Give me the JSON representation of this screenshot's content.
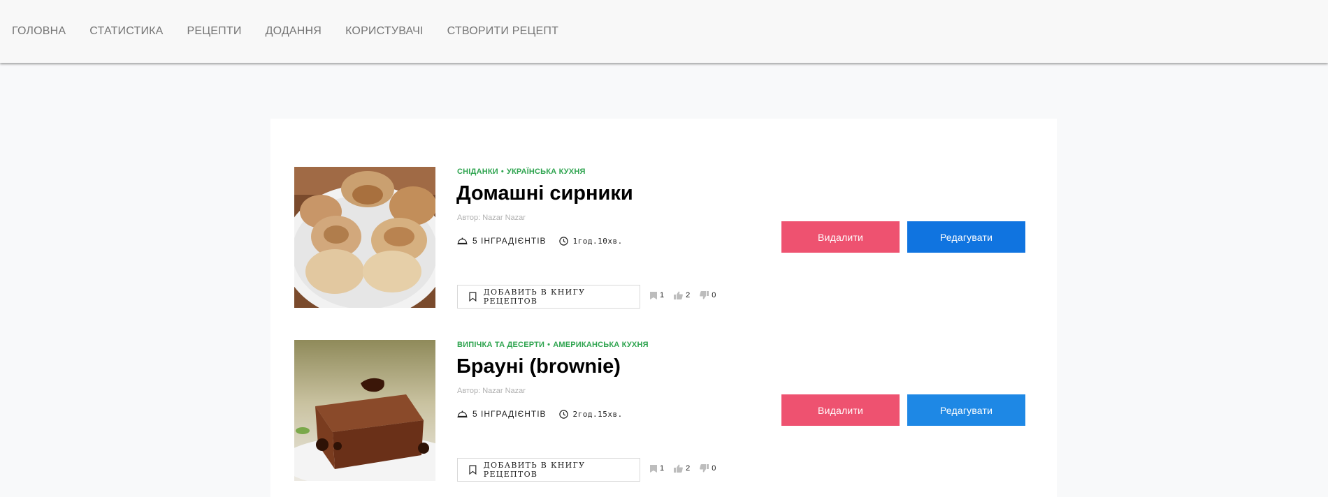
{
  "nav": {
    "items": [
      "Головна",
      "Статистика",
      "Рецепти",
      "Додання",
      "Користувачі",
      "Створити рецепт"
    ]
  },
  "colors": {
    "category": "#2ea44f",
    "delete": "#ee5270",
    "edit_primary": "#1074e0",
    "edit_secondary": "#1e88e5"
  },
  "recipes": [
    {
      "category": "Сніданки",
      "cuisine": "Українська кухня",
      "title": "Домашні сирники",
      "author": "Автор: Nazar Nazar",
      "ingredients": "5 інградієнтів",
      "time": "1год.10хв.",
      "book_label": "Добавить в книгу рецептов",
      "saves": "1",
      "likes": "2",
      "dislikes": "0",
      "delete_label": "Видалити",
      "edit_label": "Редагувати"
    },
    {
      "category": "Випічка та десерти",
      "cuisine": "Американська кухня",
      "title": "Брауні (brownie)",
      "author": "Автор: Nazar Nazar",
      "ingredients": "5 інградієнтів",
      "time": "2год.15хв.",
      "book_label": "Добавить в книгу рецептов",
      "saves": "1",
      "likes": "2",
      "dislikes": "0",
      "delete_label": "Видалити",
      "edit_label": "Редагувати"
    }
  ]
}
